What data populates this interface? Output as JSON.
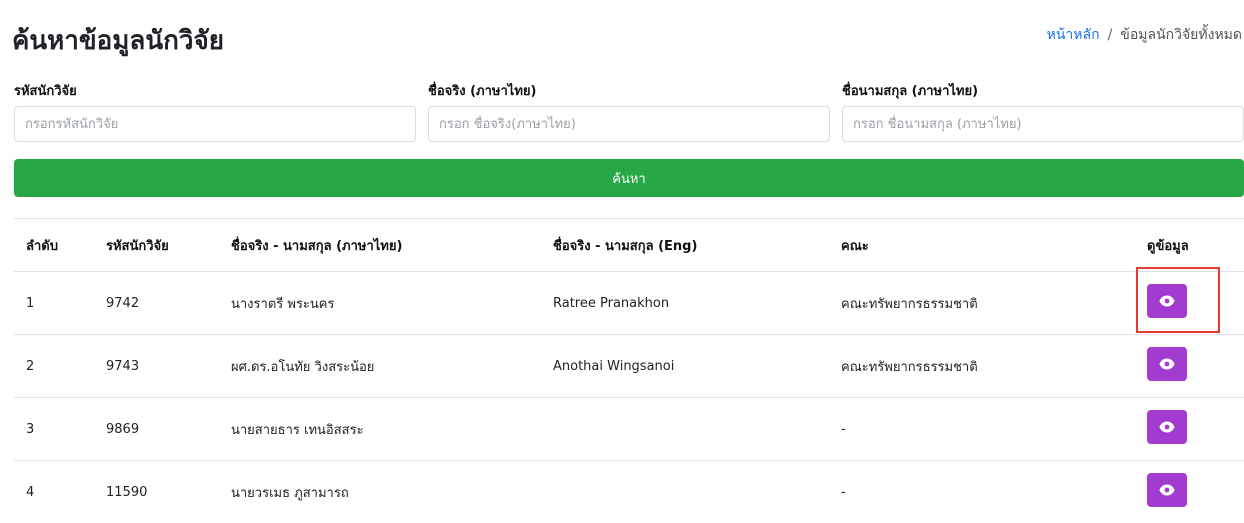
{
  "header": {
    "title": "ค้นหาข้อมูลนักวิจัย",
    "breadcrumb": {
      "home": "หน้าหลัก",
      "separator": "/",
      "current": "ข้อมูลนักวิจัยทั้งหมด"
    }
  },
  "filters": [
    {
      "label": "รหัสนักวิจัย",
      "placeholder": "กรอกรหัสนักวิจัย",
      "value": ""
    },
    {
      "label": "ชื่อจริง (ภาษาไทย)",
      "placeholder": "กรอก ชื่อจริง(ภาษาไทย)",
      "value": ""
    },
    {
      "label": "ชื่อนามสกุล (ภาษาไทย)",
      "placeholder": "กรอก ชื่อนามสกุล (ภาษาไทย)",
      "value": ""
    }
  ],
  "search_button": {
    "label": "ค้นหา",
    "color": "#28a745"
  },
  "table": {
    "headers": [
      "ลำดับ",
      "รหัสนักวิจัย",
      "ชื่อจริง - นามสกุล (ภาษาไทย)",
      "ชื่อจริง - นามสกุล (Eng)",
      "คณะ",
      "ดูข้อมูล"
    ],
    "rows": [
      {
        "no": "1",
        "id": "9742",
        "name_th": "นางราตรี พระนคร",
        "name_en": "Ratree Pranakhon",
        "faculty": "คณะทรัพยากรธรรมชาติ"
      },
      {
        "no": "2",
        "id": "9743",
        "name_th": "ผศ.ดร.อโนทัย วิงสระน้อย",
        "name_en": "Anothai Wingsanoi",
        "faculty": "คณะทรัพยากรธรรมชาติ"
      },
      {
        "no": "3",
        "id": "9869",
        "name_th": "นายสายธาร เทนอิสสระ",
        "name_en": "",
        "faculty": "-"
      },
      {
        "no": "4",
        "id": "11590",
        "name_th": "นายวรเมธ ภูสามารถ",
        "name_en": "",
        "faculty": "-"
      }
    ],
    "view_button": {
      "icon": "eye-icon",
      "color": "#a23bd0"
    }
  },
  "annotation": {
    "color": "#e53935"
  }
}
